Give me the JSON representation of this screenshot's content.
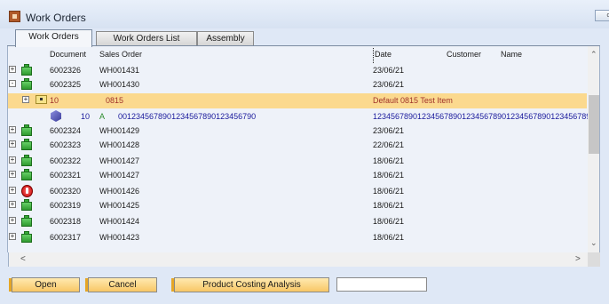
{
  "window": {
    "title": "Work Orders",
    "max_button": "c"
  },
  "tabs": [
    {
      "label": "Work Orders",
      "active": true
    },
    {
      "label": "Work Orders List",
      "active": false
    },
    {
      "label": "Assembly",
      "active": false
    }
  ],
  "columns": {
    "document": "Document",
    "sales_order": "Sales Order",
    "date": "Date",
    "customer": "Customer",
    "name": "Name"
  },
  "rows": [
    {
      "document": "6002326",
      "sales_order": "WH001431",
      "date": "23/06/21",
      "status": "green",
      "expander": "+"
    },
    {
      "document": "6002325",
      "sales_order": "WH001430",
      "date": "23/06/21",
      "status": "green",
      "expander": "-"
    },
    {
      "document": "6002324",
      "sales_order": "WH001429",
      "date": "23/06/21",
      "status": "green",
      "expander": "+"
    },
    {
      "document": "6002323",
      "sales_order": "WH001428",
      "date": "22/06/21",
      "status": "green",
      "expander": "+"
    },
    {
      "document": "6002322",
      "sales_order": "WH001427",
      "date": "18/06/21",
      "status": "green",
      "expander": "+"
    },
    {
      "document": "6002321",
      "sales_order": "WH001427",
      "date": "18/06/21",
      "status": "green",
      "expander": "+"
    },
    {
      "document": "6002320",
      "sales_order": "WH001426",
      "date": "18/06/21",
      "status": "stop",
      "expander": "+"
    },
    {
      "document": "6002319",
      "sales_order": "WH001425",
      "date": "18/06/21",
      "status": "green",
      "expander": "+"
    },
    {
      "document": "6002318",
      "sales_order": "WH001424",
      "date": "18/06/21",
      "status": "green",
      "expander": "+"
    },
    {
      "document": "6002317",
      "sales_order": "WH001423",
      "date": "18/06/21",
      "status": "green",
      "expander": "+"
    }
  ],
  "selected_child": {
    "line": "10",
    "code": "0815",
    "description": "Default 0815 Test Item",
    "expander": "+"
  },
  "sub_child": {
    "line": "10",
    "type": "A",
    "code": "0012345678901234567890123456790",
    "description": "1234567890123456789012345678901234567890123456789"
  },
  "buttons": {
    "open": "Open",
    "cancel": "Cancel",
    "product_costing": "Product Costing Analysis"
  },
  "colors": {
    "selected_row": "#fbd98e",
    "button": "#f8c766",
    "dark_red_text": "#a0322a",
    "blue_text": "#1a1a9c"
  }
}
